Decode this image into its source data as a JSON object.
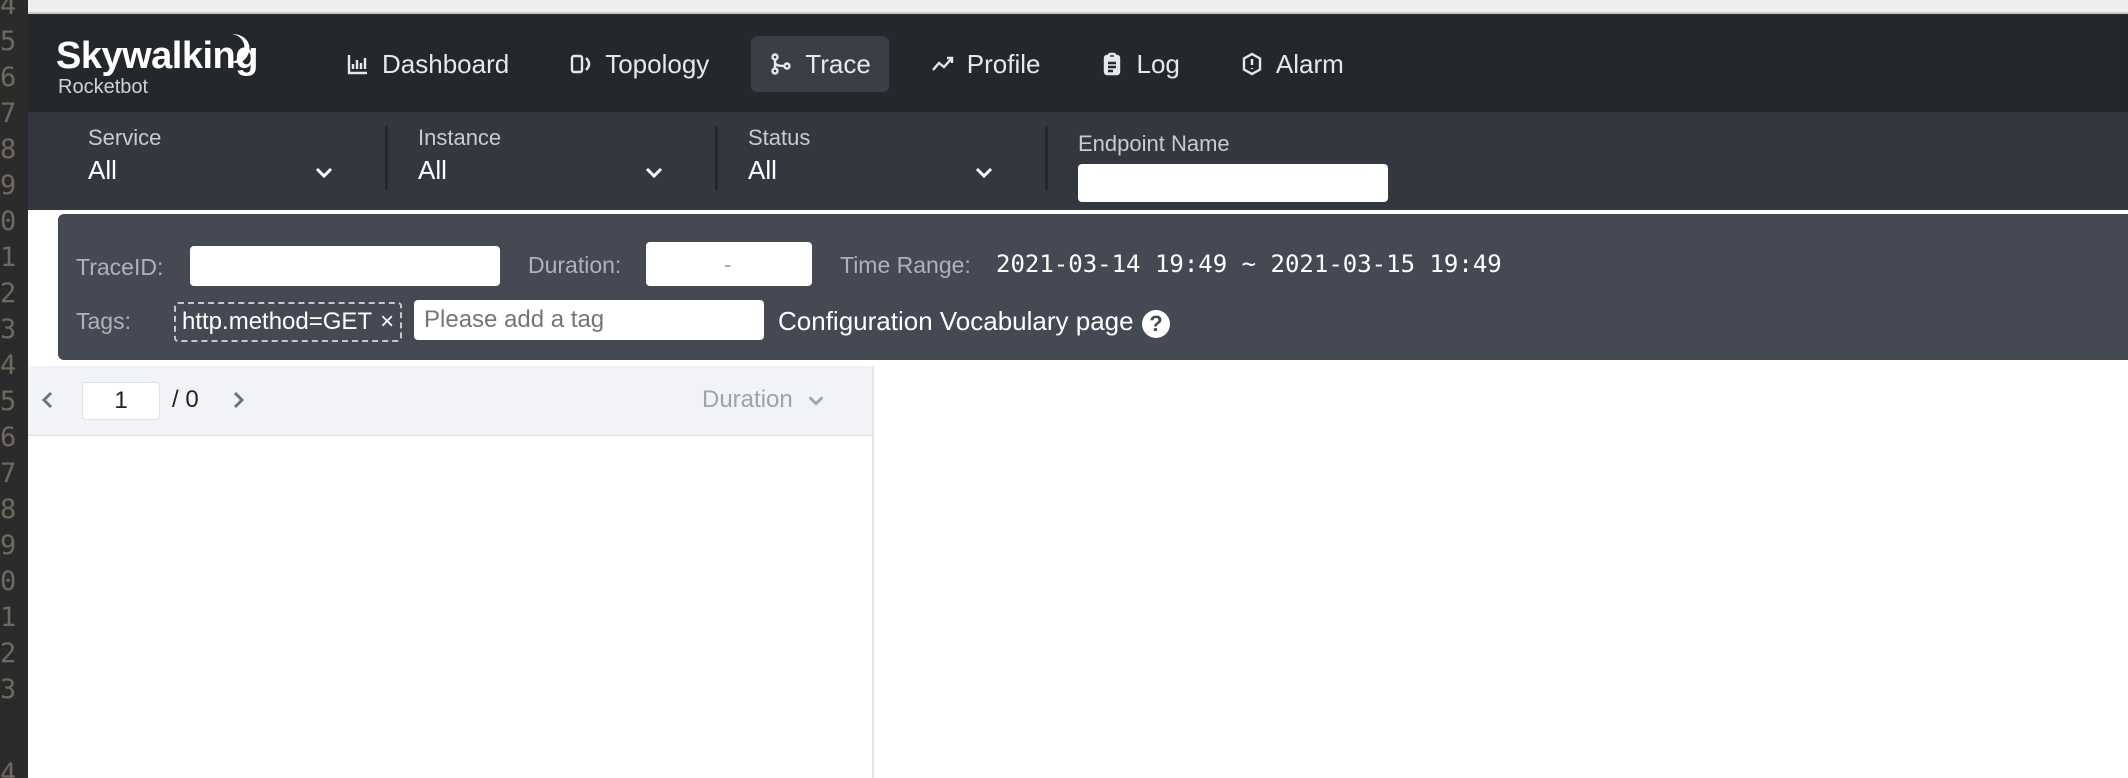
{
  "gutter": {
    "numbers": [
      "4",
      "5",
      "6",
      "7",
      "8",
      "9",
      "0",
      "1",
      "2",
      "3",
      "4",
      "5",
      "6",
      "7",
      "8",
      "9",
      "0",
      "1",
      "2",
      "3",
      "4"
    ]
  },
  "header": {
    "logo_text": "Skywalking",
    "logo_sub": "Rocketbot",
    "nav": [
      {
        "label": "Dashboard",
        "icon": "bar-chart-icon"
      },
      {
        "label": "Topology",
        "icon": "topology-icon"
      },
      {
        "label": "Trace",
        "icon": "trace-icon",
        "active": true
      },
      {
        "label": "Profile",
        "icon": "trend-icon"
      },
      {
        "label": "Log",
        "icon": "clipboard-icon"
      },
      {
        "label": "Alarm",
        "icon": "alarm-icon"
      }
    ]
  },
  "filters": {
    "service": {
      "label": "Service",
      "value": "All"
    },
    "instance": {
      "label": "Instance",
      "value": "All"
    },
    "status": {
      "label": "Status",
      "value": "All"
    },
    "endpoint": {
      "label": "Endpoint Name",
      "value": ""
    }
  },
  "search": {
    "trace_id_label": "TraceID:",
    "trace_id_value": "",
    "duration_label": "Duration:",
    "duration_sep": "-",
    "time_range_label": "Time Range:",
    "time_range_value": "2021-03-14 19:49 ~ 2021-03-15 19:49",
    "tags_label": "Tags:",
    "tags": [
      "http.method=GET"
    ],
    "tag_remove": "×",
    "tag_placeholder": "Please add a tag",
    "config_link": "Configuration Vocabulary page",
    "help": "?"
  },
  "list": {
    "page": "1",
    "total": "/ 0",
    "sort_label": "Duration"
  },
  "colors": {
    "header_bg": "#24272c",
    "filter_bg": "#333840",
    "search_bg": "#444953",
    "active_nav": "#3a3e47"
  }
}
